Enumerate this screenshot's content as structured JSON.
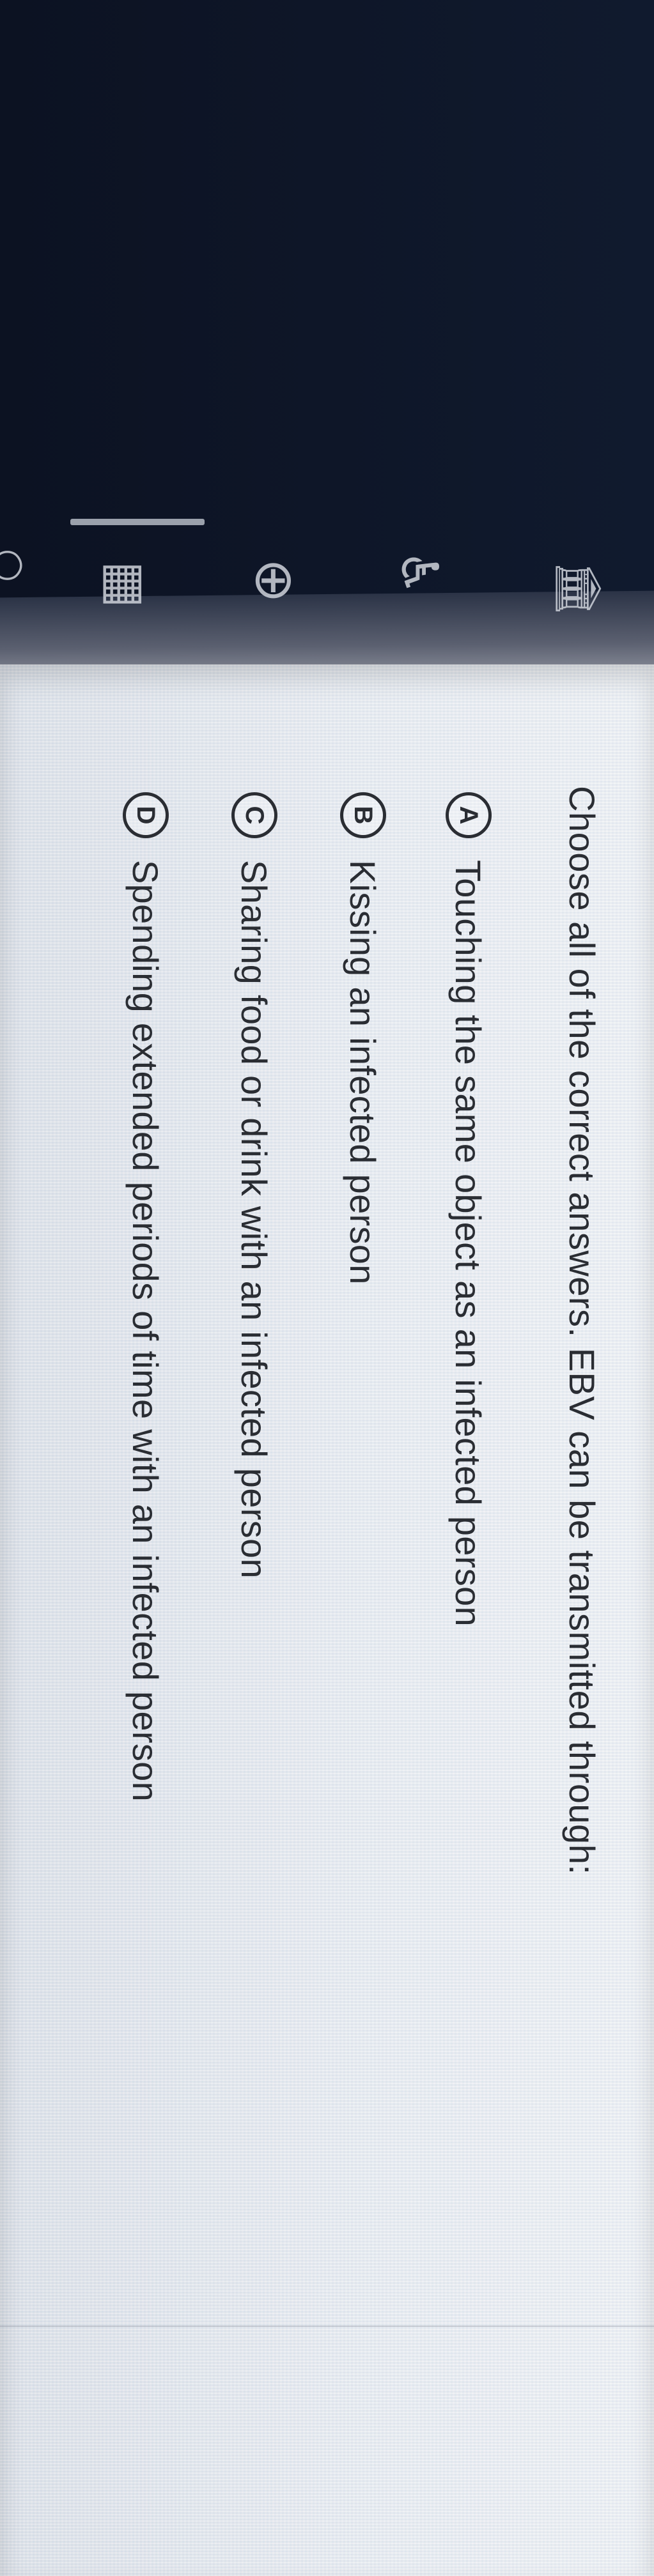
{
  "question": {
    "prompt": "Choose all of the correct answers. EBV can be transmitted through:"
  },
  "options": [
    {
      "letter": "A",
      "text": "Touching the same object as an infected person"
    },
    {
      "letter": "B",
      "text": "Kissing an infected person"
    },
    {
      "letter": "C",
      "text": "Sharing food or drink with an infected person"
    },
    {
      "letter": "D",
      "text": "Spending extended periods of time with an infected person"
    }
  ],
  "toolbar": {
    "icons": [
      "bank-icon",
      "calculator-icon",
      "globe-icon",
      "accessibility-icon",
      "zoom-icon"
    ]
  },
  "colors": {
    "text": "#2a2d33",
    "screen_background": "#e6e9ee",
    "bezel": "#0d1220"
  }
}
